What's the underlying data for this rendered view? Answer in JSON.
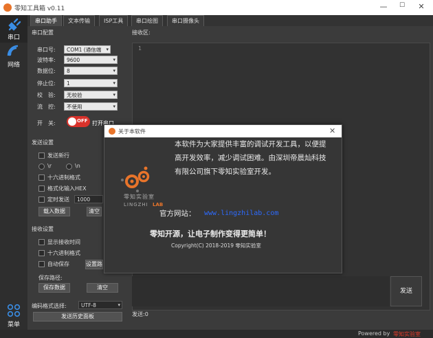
{
  "window": {
    "title": "零知工具箱 v0.11",
    "minimize": "—",
    "maximize": "☐",
    "close": "✕"
  },
  "nav": [
    {
      "label": "串口",
      "icon": "plug-icon"
    },
    {
      "label": "网络",
      "icon": "wifi-icon"
    },
    {
      "label": "菜单",
      "icon": "grid-icon"
    }
  ],
  "tabs": [
    "串口助手",
    "文本传输",
    "ISP工具",
    "串口绘图",
    "串口摄像头"
  ],
  "serial_config": {
    "title": "串口配置",
    "port_label": "串口号:",
    "port_value": "COM1 (通信端",
    "baud_label": "波特率:",
    "baud_value": "9600",
    "data_label": "数据位:",
    "data_value": "8",
    "stop_label": "停止位:",
    "stop_value": "1",
    "parity_label": "校　验:",
    "parity_value": "无校验",
    "flow_label": "流　控:",
    "flow_value": "不使用",
    "switch_label": "开　关:",
    "toggle_state": "OFF",
    "open_label": "打开串口"
  },
  "send_settings": {
    "title": "发送设置",
    "loop_label": "发送新行",
    "r_label": "\\r",
    "n_label": "\\n",
    "hex_label": "十六进制格式",
    "format_label": "格式化输入HEX",
    "timer_label": "定时发送",
    "timer_value": "1000",
    "load_button": "载入数据",
    "clear_button": "清空"
  },
  "recv_settings": {
    "title": "接收设置",
    "show_time_label": "显示接收时间",
    "hex_label": "十六进制格式",
    "autosave_label": "自动保存",
    "settings_button": "设置路",
    "path_label": "保存路径:",
    "save_button": "保存数据",
    "clear_button": "清空"
  },
  "encoding": {
    "label": "编码格式选择:",
    "value": "UTF-8",
    "history_button": "发送历史面板"
  },
  "receive_area": {
    "label": "接收区:",
    "line_number": "1"
  },
  "send_area": {
    "send_button": "发送",
    "count_label": "发送:0"
  },
  "status": {
    "powered": "Powered by",
    "brand": "零知实验室"
  },
  "dialog": {
    "title": "关于本软件",
    "close": "✕",
    "line1": "本软件为大家提供丰富的调试开发工具，以便提",
    "line2": "高开发效率，减少调试困难。由深圳帝晨灿科技",
    "line3": "有限公司旗下零知实验室开发。",
    "website_label": "官方网站：",
    "website_url": "www.lingzhilab.com",
    "slogan": "零知开源，让电子制作变得更简单！",
    "copyright": "Copyright(C) 2018-2019 零知实验室",
    "logo_cn": "零知实验室",
    "logo_en_left": "LINGZHI",
    "logo_en_right": "LAB"
  },
  "colors": {
    "accent": "#e8742a",
    "toggle_red": "#d9322b",
    "link_blue": "#2d6bff",
    "brand_red": "#e23b2b"
  }
}
